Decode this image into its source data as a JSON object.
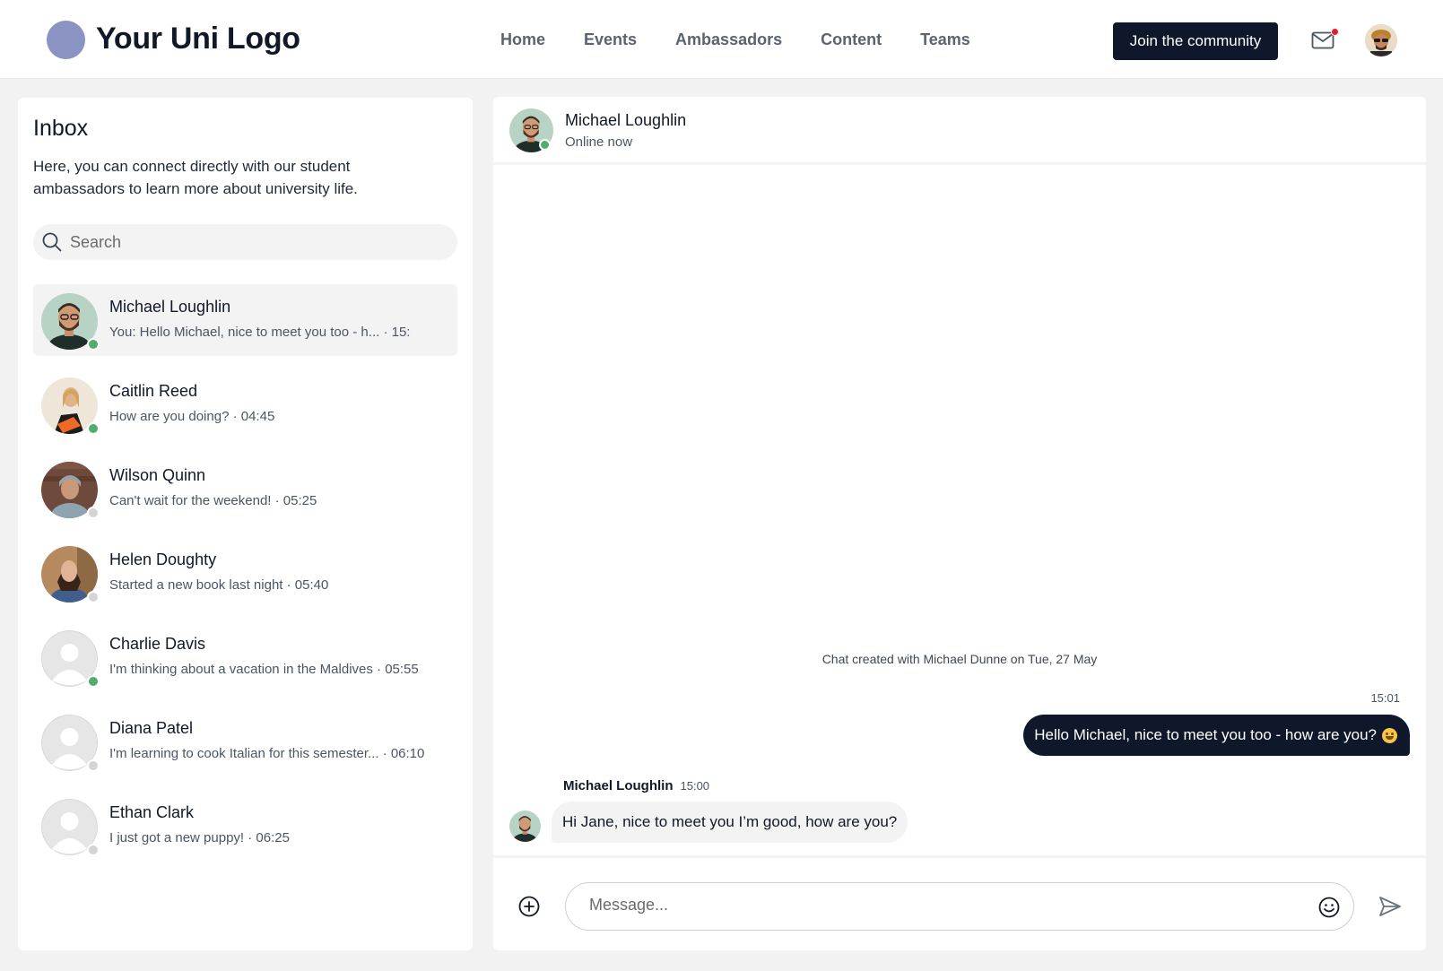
{
  "header": {
    "logo_text": "Your Uni Logo",
    "nav": [
      "Home",
      "Events",
      "Ambassadors",
      "Content",
      "Teams"
    ],
    "join_label": "Join the community",
    "mail_icon": "mail-icon",
    "colors": {
      "primary": "#0f172a",
      "logo": "#8b93c2",
      "notification": "#e11d2e"
    }
  },
  "inbox": {
    "title": "Inbox",
    "description": "Here, you can connect directly with our student ambassadors to learn more about university life.",
    "search_placeholder": "Search",
    "conversations": [
      {
        "name": "Michael Loughlin",
        "preview": "You: Hello Michael, nice to meet you too - h... · 15:",
        "online": true,
        "active": true
      },
      {
        "name": "Caitlin Reed",
        "preview": "How are you doing? · 04:45",
        "online": true,
        "active": false
      },
      {
        "name": "Wilson Quinn",
        "preview": "Can't wait for the weekend! · 05:25",
        "online": false,
        "active": false
      },
      {
        "name": "Helen Doughty",
        "preview": "Started a new book last night · 05:40",
        "online": false,
        "active": false
      },
      {
        "name": "Charlie Davis",
        "preview": "I'm thinking about a vacation in the Maldives · 05:55",
        "online": true,
        "active": false
      },
      {
        "name": "Diana Patel",
        "preview": "I'm learning to cook Italian for this semester... · 06:10",
        "online": false,
        "active": false
      },
      {
        "name": "Ethan Clark",
        "preview": "I just got a new puppy! · 06:25",
        "online": false,
        "active": false
      }
    ]
  },
  "chat": {
    "contact_name": "Michael Loughlin",
    "contact_status": "Online now",
    "created_note": "Chat created with Michael Dunne on Tue, 27 May",
    "outgoing": {
      "time": "15:01",
      "text": "Hello Michael, nice to meet you too - how are you?"
    },
    "incoming": {
      "sender": "Michael Loughlin",
      "time": "15:00",
      "text": "Hi Jane, nice to meet you I’m good, how are you?"
    },
    "message_placeholder": "Message..."
  }
}
